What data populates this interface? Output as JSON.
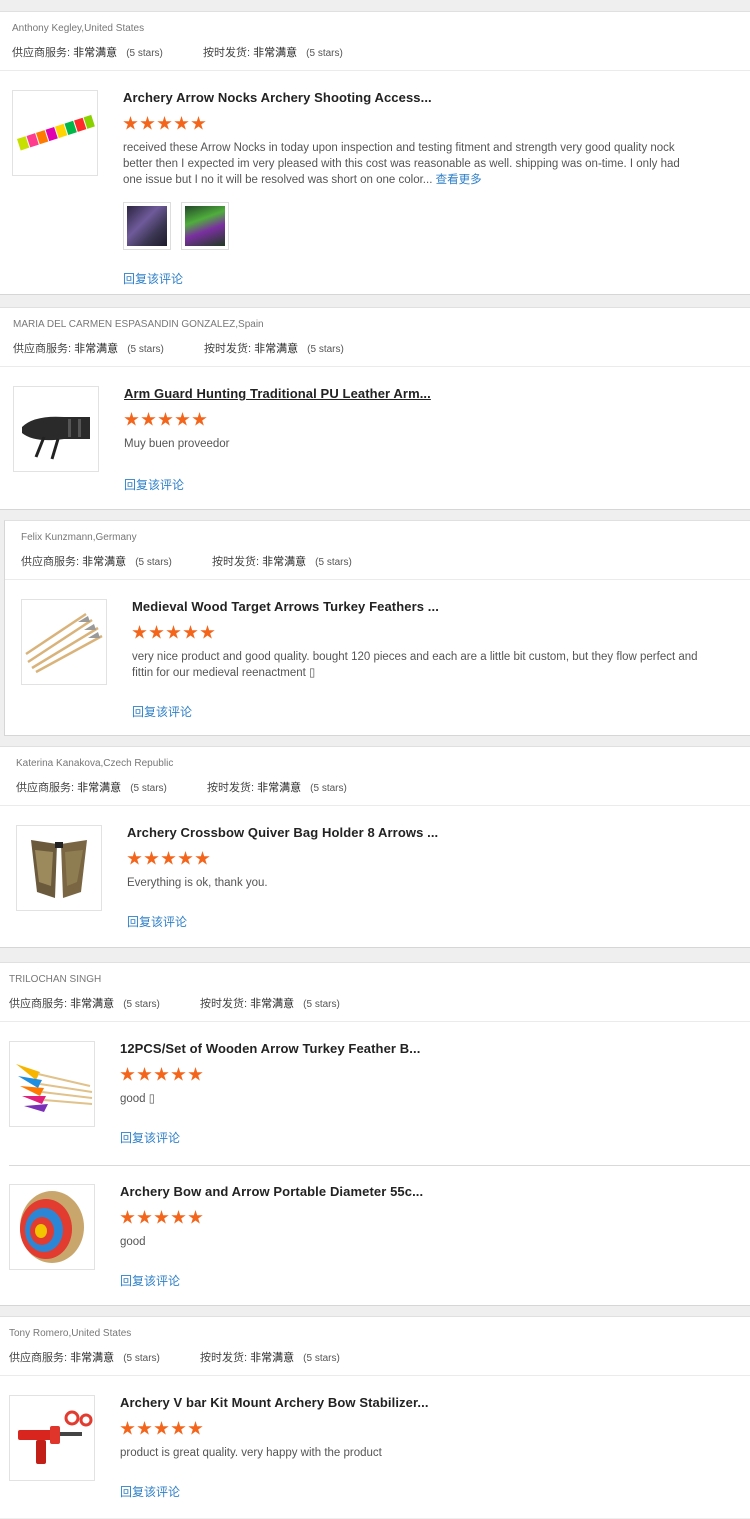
{
  "labels": {
    "supplier_service": "供应商服务:",
    "on_time_shipping": "按时发货:",
    "very_satisfied": "非常满意",
    "five_stars": "(5 stars)",
    "reply": "回复该评论",
    "see_more": "查看更多"
  },
  "colors": {
    "star": "#f4651c",
    "link": "#2f80c9"
  },
  "reviews": [
    {
      "buyer": "Anthony Kegley,United States",
      "items": [
        {
          "title": "Archery Arrow Nocks Archery Shooting Access...",
          "rating": 5,
          "text": "received these Arrow Nocks in today upon inspection and testing fitment and strength very good quality nock better then I expected im very pleased with this cost was reasonable as well. shipping was on-time. I only had one issue but I no it will be resolved was short on one color...",
          "has_more": true,
          "photos": 2,
          "image": "arrow-nocks-icon"
        }
      ]
    },
    {
      "buyer": "MARIA DEL CARMEN ESPASANDIN GONZALEZ,Spain",
      "items": [
        {
          "title": "Arm Guard Hunting Traditional PU Leather Arm...",
          "rating": 5,
          "text": "Muy buen proveedor",
          "image": "arm-guard-icon"
        }
      ]
    },
    {
      "buyer": "Felix Kunzmann,Germany",
      "items": [
        {
          "title": "Medieval Wood Target Arrows Turkey Feathers ...",
          "rating": 5,
          "text": "very nice product and good quality. bought 120 pieces and each are a little bit custom, but they flow perfect and fittin for our medieval reenactment ▯",
          "image": "wood-arrows-icon"
        }
      ]
    },
    {
      "buyer": "Katerina Kanakova,Czech Republic",
      "items": [
        {
          "title": "Archery Crossbow Quiver Bag Holder 8 Arrows ...",
          "rating": 5,
          "text": "Everything is ok, thank you.",
          "image": "quiver-bag-icon"
        }
      ]
    },
    {
      "buyer": "TRILOCHAN SINGH",
      "items": [
        {
          "title": "12PCS/Set of Wooden Arrow Turkey Feather B...",
          "rating": 5,
          "text": "good ▯",
          "image": "feather-arrows-icon"
        },
        {
          "title": "Archery Bow and Arrow Portable Diameter 55c...",
          "rating": 5,
          "text": "good",
          "image": "straw-target-icon"
        }
      ]
    },
    {
      "buyer": "Tony Romero,United States",
      "items": [
        {
          "title": "Archery V bar Kit Mount Archery Bow Stabilizer...",
          "rating": 5,
          "text": "product is great quality. very happy with the product",
          "image": "stabilizer-mount-icon"
        }
      ]
    }
  ]
}
